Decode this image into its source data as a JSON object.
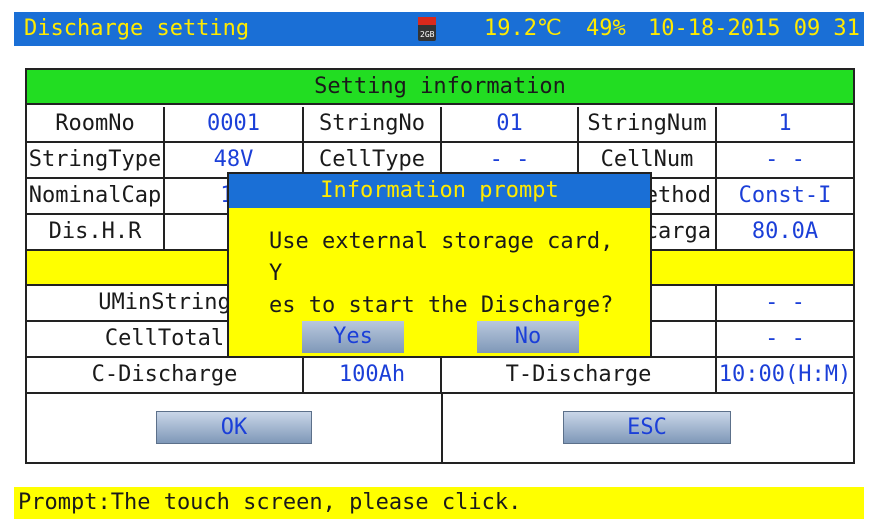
{
  "header": {
    "title": "Discharge setting",
    "sd_icon_label": "2GB",
    "temperature": "19.2℃",
    "battery": "49%",
    "datetime": "10-18-2015 09 31"
  },
  "panel": {
    "title": "Setting information",
    "rows": [
      [
        {
          "label": "RoomNo"
        },
        {
          "value": "0001"
        },
        {
          "label": "StringNo"
        },
        {
          "value": "01"
        },
        {
          "label": "StringNum"
        },
        {
          "value": "1"
        }
      ],
      [
        {
          "label": "StringType"
        },
        {
          "value": "48V"
        },
        {
          "label": "CellType"
        },
        {
          "value": "- -"
        },
        {
          "label": "CellNum"
        },
        {
          "value": "- -"
        }
      ],
      [
        {
          "label": "NominalCap"
        },
        {
          "value": "10"
        },
        {
          "label": ""
        },
        {
          "value": ""
        },
        {
          "label": "ethod"
        },
        {
          "value": "Const-I"
        }
      ],
      [
        {
          "label": "Dis.H.R"
        },
        {
          "value": ""
        },
        {
          "label": ""
        },
        {
          "value": ""
        },
        {
          "label": "carga"
        },
        {
          "value": "80.0A"
        }
      ]
    ],
    "limit_rows": [
      {
        "label": "UMinString",
        "value": "- -"
      },
      {
        "label": "CellTotal",
        "value": "- -"
      }
    ],
    "c_discharge": {
      "label": "C-Discharge",
      "value": "100Ah"
    },
    "t_discharge": {
      "label": "T-Discharge",
      "value": "10:00(H:M)"
    },
    "ok_label": "OK",
    "esc_label": "ESC"
  },
  "dialog": {
    "title": "Information prompt",
    "message_line1": "Use external storage card, Y",
    "message_line2": "es to start the Discharge?",
    "yes_label": "Yes",
    "no_label": "No"
  },
  "prompt": "Prompt:The touch screen, please click.",
  "colors": {
    "title_bar": "#1a6fd6",
    "header_row": "#22dd22",
    "yellow": "#ffff00",
    "value_text": "#1b3fd8"
  }
}
